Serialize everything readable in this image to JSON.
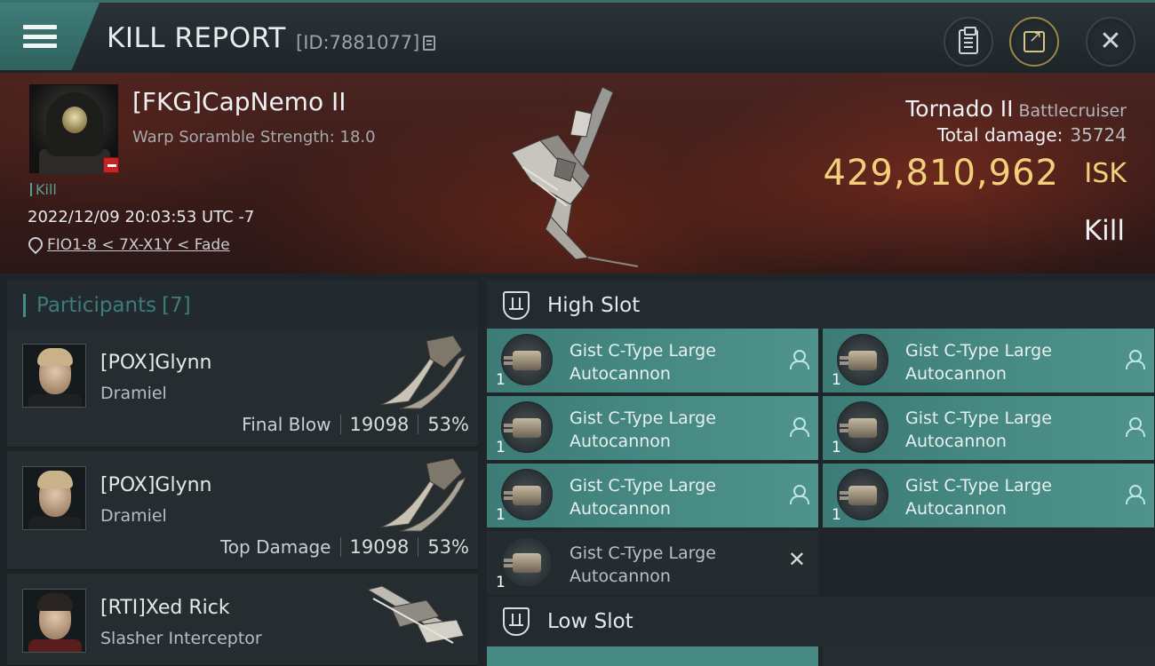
{
  "header": {
    "title": "KILL REPORT",
    "report_id": "[ID:7881077]"
  },
  "victim": {
    "name": "[FKG]CapNemo II",
    "subtitle": "Warp Soramble Strength: 18.0",
    "kill_tag": "Kill",
    "timestamp": "2022/12/09 20:03:53 UTC -7",
    "location": "FIO1-8 < 7X-X1Y < Fade",
    "ship_name": "Tornado II",
    "ship_class": "Battlecruiser",
    "total_damage_label": "Total damage:",
    "total_damage": "35724",
    "isk_value": "429,810,962",
    "isk_unit": "ISK",
    "result": "Kill"
  },
  "participants": {
    "title": "Participants",
    "count": "[7]",
    "items": [
      {
        "name": "[POX]Glynn",
        "ship": "Dramiel",
        "tag": "Final Blow",
        "damage": "19098",
        "percent": "53%"
      },
      {
        "name": "[POX]Glynn",
        "ship": "Dramiel",
        "tag": "Top Damage",
        "damage": "19098",
        "percent": "53%"
      },
      {
        "name": "[RTI]Xed Rick",
        "ship": "Slasher Interceptor"
      }
    ]
  },
  "slots": {
    "high": {
      "title": "High Slot",
      "modules": [
        {
          "name_line1": "Gist C-Type Large",
          "name_line2": "Autocannon",
          "qty": "1",
          "status": "destroyed"
        },
        {
          "name_line1": "Gist C-Type Large",
          "name_line2": "Autocannon",
          "qty": "1",
          "status": "destroyed"
        },
        {
          "name_line1": "Gist C-Type Large",
          "name_line2": "Autocannon",
          "qty": "1",
          "status": "destroyed"
        },
        {
          "name_line1": "Gist C-Type Large",
          "name_line2": "Autocannon",
          "qty": "1",
          "status": "destroyed"
        },
        {
          "name_line1": "Gist C-Type Large",
          "name_line2": "Autocannon",
          "qty": "1",
          "status": "destroyed"
        },
        {
          "name_line1": "Gist C-Type Large",
          "name_line2": "Autocannon",
          "qty": "1",
          "status": "destroyed"
        },
        {
          "name_line1": "Gist C-Type Large",
          "name_line2": "Autocannon",
          "qty": "1",
          "status": "dropped"
        }
      ]
    },
    "low": {
      "title": "Low Slot"
    }
  },
  "colors": {
    "accent_teal": "#3f8f88",
    "isk_gold": "#f2cf7a",
    "module_destroyed": "#478a84",
    "module_dropped": "#252c30"
  }
}
